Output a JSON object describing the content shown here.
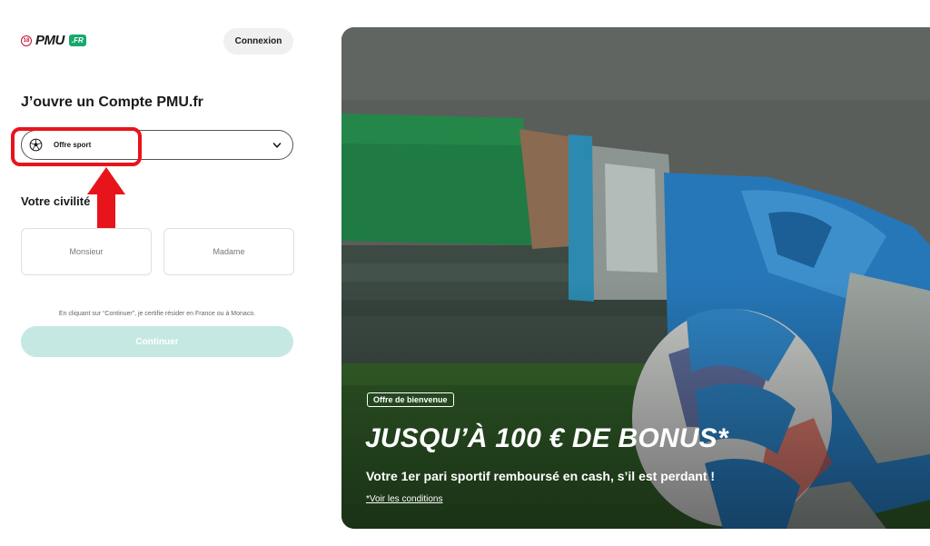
{
  "header": {
    "logo_age": "18",
    "logo_brand": "PMU",
    "logo_suffix": ".FR",
    "login_label": "Connexion"
  },
  "form": {
    "title": "J’ouvre un Compte PMU.fr",
    "offer": {
      "selected": "Offre sport",
      "icon": "soccer-ball-icon",
      "chevron": "chevron-down-icon"
    },
    "civility": {
      "title": "Votre civilité",
      "options": [
        "Monsieur",
        "Madame"
      ]
    },
    "disclaimer": "En cliquant sur “Continuer”, je certifie résider en France ou à Monaco.",
    "continue_label": "Continuer"
  },
  "annotation": {
    "highlight_color": "#e8141b"
  },
  "hero": {
    "badge": "Offre de bienvenue",
    "headline": "JUSQU’À 100 € DE BONUS*",
    "subline": "Votre 1er pari sportif remboursé en cash, s’il est perdant !",
    "conditions_link": "*Voir les conditions"
  },
  "colors": {
    "brand_green": "#17a86b",
    "continue_disabled": "#c6e8e2",
    "age_red": "#c8102e"
  }
}
